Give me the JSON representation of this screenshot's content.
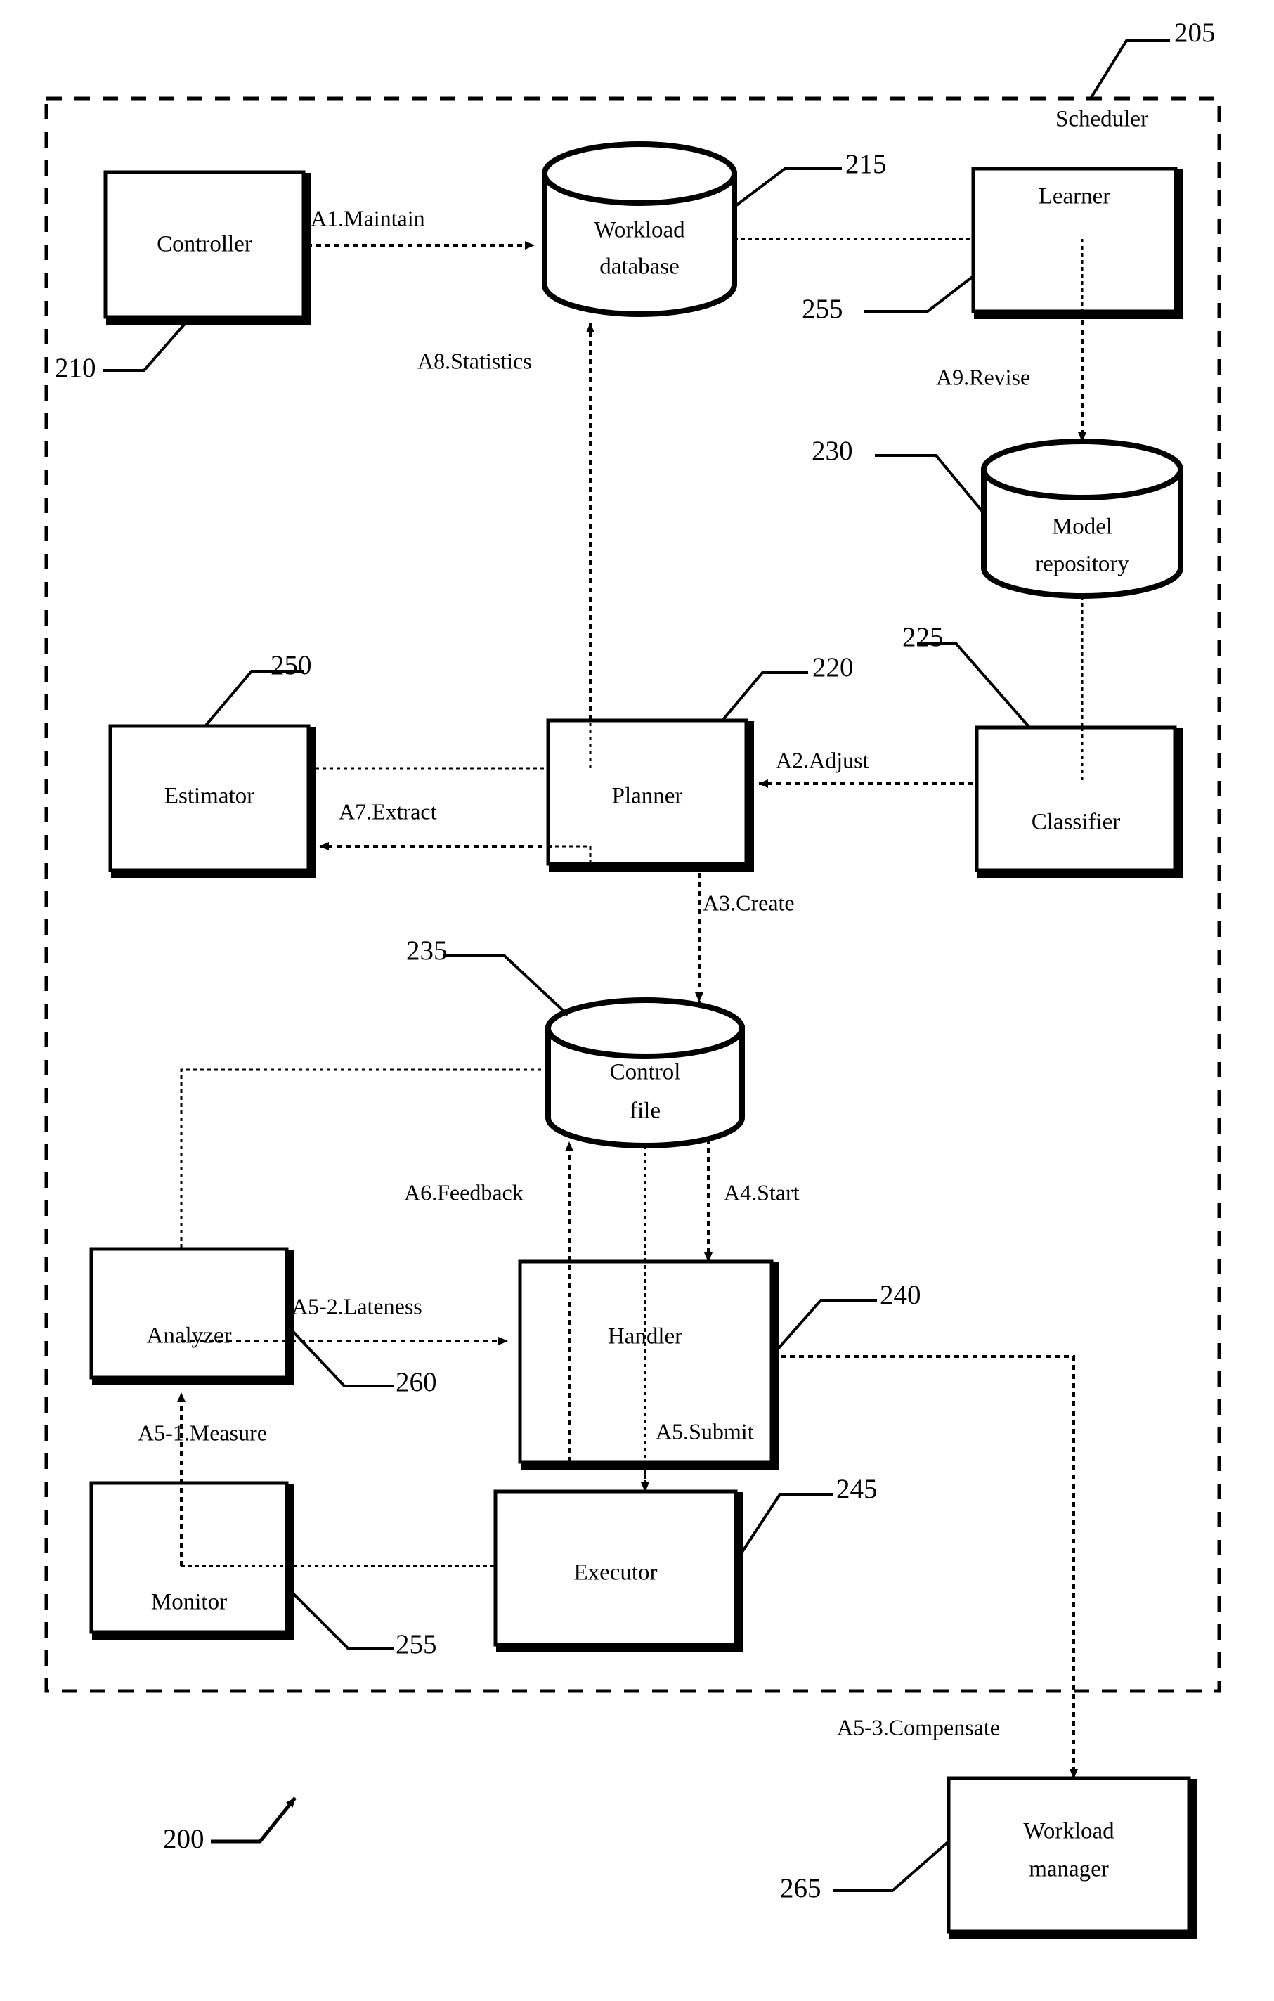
{
  "figure": {
    "ref_number": "200",
    "region": {
      "name": "scheduler-region",
      "label": "Scheduler",
      "ref_number": "205"
    }
  },
  "nodes": [
    {
      "id": "controller",
      "shape": "box",
      "label": "Controller",
      "ref_number": "210"
    },
    {
      "id": "workload-database",
      "shape": "cylinder",
      "label_line1": "Workload",
      "label_line2": "database",
      "ref_number": "215"
    },
    {
      "id": "learner",
      "shape": "box",
      "label": "Learner",
      "ref_number": "255"
    },
    {
      "id": "model-repository",
      "shape": "cylinder",
      "label_line1": "Model",
      "label_line2": "repository",
      "ref_number": "230"
    },
    {
      "id": "estimator",
      "shape": "box",
      "label": "Estimator",
      "ref_number": "250"
    },
    {
      "id": "planner",
      "shape": "box",
      "label": "Planner",
      "ref_number": "220"
    },
    {
      "id": "classifier",
      "shape": "box",
      "label": "Classifier",
      "ref_number": "225"
    },
    {
      "id": "control-file",
      "shape": "cylinder",
      "label_line1": "Control",
      "label_line2": "file",
      "ref_number": "235"
    },
    {
      "id": "analyzer",
      "shape": "box",
      "label": "Analyzer",
      "ref_number": "260"
    },
    {
      "id": "handler",
      "shape": "box",
      "label": "Handler",
      "ref_number": "240"
    },
    {
      "id": "monitor",
      "shape": "box",
      "label": "Monitor",
      "ref_number": "255"
    },
    {
      "id": "executor",
      "shape": "box",
      "label": "Executor",
      "ref_number": "245"
    },
    {
      "id": "workload-manager",
      "shape": "box",
      "label_line1": "Workload",
      "label_line2": "manager",
      "ref_number": "265"
    }
  ],
  "flows": [
    {
      "id": "a1",
      "label": "A1.Maintain",
      "from": "controller",
      "to": "workload-database"
    },
    {
      "id": "a8",
      "label": "A8.Statistics",
      "from": "planner",
      "to": "workload-database"
    },
    {
      "id": "a9",
      "label": "A9.Revise",
      "from": "learner",
      "to": "model-repository"
    },
    {
      "id": "a2",
      "label": "A2.Adjust",
      "from": "classifier",
      "to": "planner"
    },
    {
      "id": "a7",
      "label": "A7.Extract",
      "from": "planner",
      "to": "estimator"
    },
    {
      "id": "a3",
      "label": "A3.Create",
      "from": "planner",
      "to": "control-file"
    },
    {
      "id": "a6",
      "label": "A6.Feedback",
      "from": "handler",
      "to": "control-file"
    },
    {
      "id": "a4",
      "label": "A4.Start",
      "from": "control-file",
      "to": "handler"
    },
    {
      "id": "a52",
      "label": "A5-2.Lateness",
      "from": "analyzer",
      "to": "handler"
    },
    {
      "id": "a51",
      "label": "A5-1.Measure",
      "from": "monitor",
      "to": "analyzer"
    },
    {
      "id": "a5",
      "label": "A5.Submit",
      "from": "handler",
      "to": "executor"
    },
    {
      "id": "a53",
      "label": "A5-3.Compensate",
      "from": "handler",
      "to": "workload-manager"
    }
  ],
  "ref_labels": {
    "fig": "200",
    "scheduler": "205",
    "controller": "210",
    "workload_db": "215",
    "planner": "220",
    "classifier": "225",
    "model_repo": "230",
    "control_file": "235",
    "handler": "240",
    "executor": "245",
    "estimator": "250",
    "learner": "255",
    "monitor": "255",
    "analyzer": "260",
    "workload_manager": "265"
  },
  "node_labels": {
    "controller": "Controller",
    "workload_db_l1": "Workload",
    "workload_db_l2": "database",
    "learner": "Learner",
    "model_repo_l1": "Model",
    "model_repo_l2": "repository",
    "estimator": "Estimator",
    "planner": "Planner",
    "classifier": "Classifier",
    "control_file_l1": "Control",
    "control_file_l2": "file",
    "analyzer": "Analyzer",
    "handler": "Handler",
    "monitor": "Monitor",
    "executor": "Executor",
    "workload_mgr_l1": "Workload",
    "workload_mgr_l2": "manager",
    "scheduler": "Scheduler"
  },
  "flow_labels": {
    "a1_maintain": "A1.Maintain",
    "a8_statistics": "A8.Statistics",
    "a9_revise": "A9.Revise",
    "a2_adjust": "A2.Adjust",
    "a7_extract": "A7.Extract",
    "a3_create": "A3.Create",
    "a6_feedback": "A6.Feedback",
    "a4_start": "A4.Start",
    "a52_lateness": "A5-2.Lateness",
    "a51_measure": "A5-1.Measure",
    "a5_submit": "A5.Submit",
    "a53_compensate": "A5-3.Compensate"
  },
  "colors": {
    "stroke": "#000000",
    "background": "#ffffff"
  }
}
